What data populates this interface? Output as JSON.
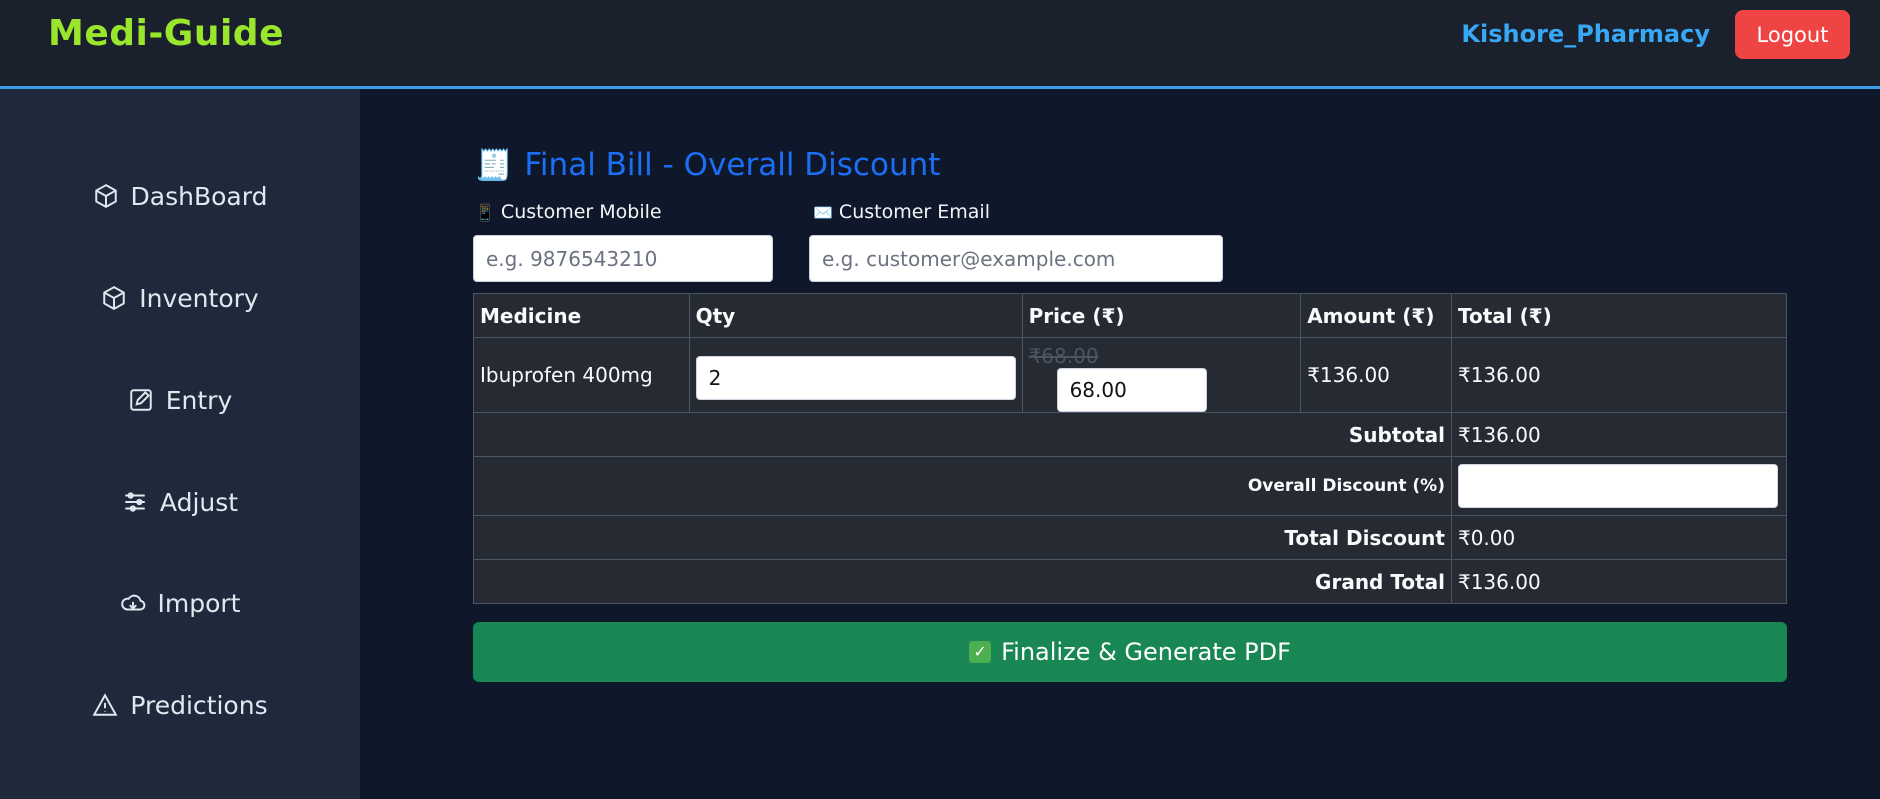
{
  "header": {
    "brand": "Medi-Guide",
    "user": "Kishore_Pharmacy",
    "logout_label": "Logout"
  },
  "sidebar": {
    "items": [
      {
        "label": "DashBoard",
        "icon": "cube-icon"
      },
      {
        "label": "Inventory",
        "icon": "cube-icon"
      },
      {
        "label": "Entry",
        "icon": "edit-icon"
      },
      {
        "label": "Adjust",
        "icon": "sliders-icon"
      },
      {
        "label": "Import",
        "icon": "cloud-download-icon"
      },
      {
        "label": "Predictions",
        "icon": "warning-icon"
      }
    ]
  },
  "bill": {
    "title_emoji": "🧾",
    "title": "Final Bill - Overall Discount",
    "mobile_emoji": "📱",
    "mobile_label": "Customer Mobile",
    "mobile_placeholder": "e.g. 9876543210",
    "email_emoji": "✉️",
    "email_label": "Customer Email",
    "email_placeholder": "e.g. customer@example.com",
    "columns": [
      "Medicine",
      "Qty",
      "Price (₹)",
      "Amount (₹)",
      "Total (₹)"
    ],
    "items": [
      {
        "medicine": "Ibuprofen 400mg",
        "qty": "2",
        "original_price": "₹68.00",
        "price": "68.00",
        "amount": "₹136.00",
        "total": "₹136.00"
      }
    ],
    "subtotal_label": "Subtotal",
    "subtotal": "₹136.00",
    "overall_discount_label": "Overall Discount (%)",
    "overall_discount_value": "",
    "total_discount_label": "Total Discount",
    "total_discount": "₹0.00",
    "grand_total_label": "Grand Total",
    "grand_total": "₹136.00",
    "finalize_emoji": "✓",
    "finalize_label": "Finalize & Generate PDF"
  },
  "colors": {
    "brand": "#9ae62c",
    "user": "#38a8f5",
    "logout": "#ef4444",
    "title": "#1b6ff5",
    "finalize": "#198754"
  }
}
